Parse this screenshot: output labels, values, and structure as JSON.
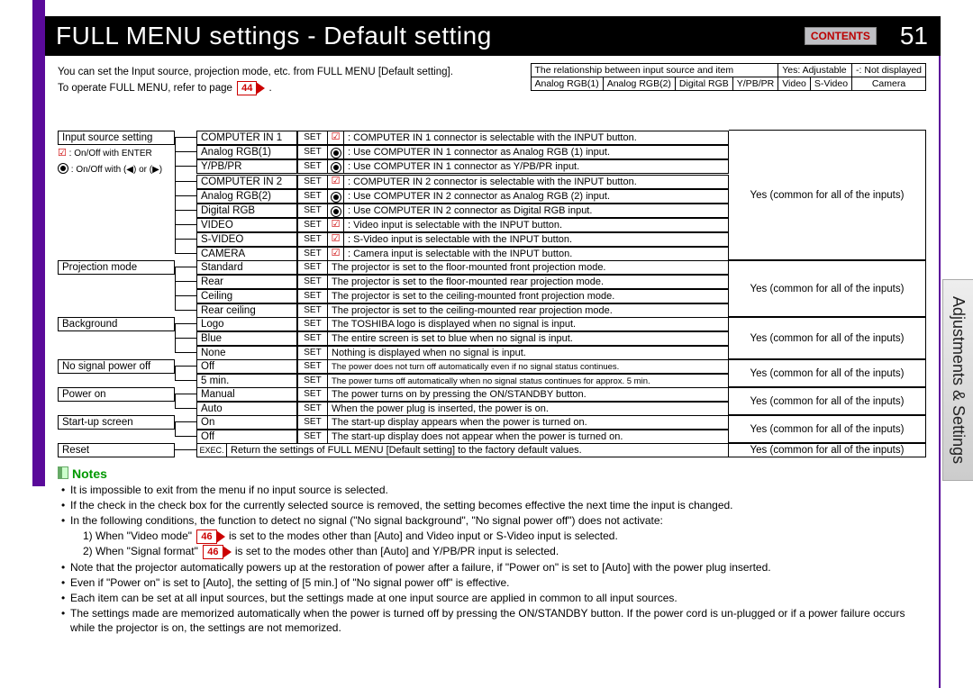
{
  "header": {
    "title": "FULL MENU settings - Default setting",
    "contents_btn": "CONTENTS",
    "page_number": "51",
    "side_tab": "Adjustments & Settings"
  },
  "intro": {
    "line1": "You can set the Input source, projection mode, etc. from FULL MENU [Default setting].",
    "line2_pre": "To operate FULL MENU, refer to page ",
    "line2_ref": "44",
    "line2_post": "."
  },
  "legend": {
    "cb": ": On/Off with ENTER",
    "dot_pre": ": On/Off with (",
    "dot_mid": ") or (",
    "dot_post": ")"
  },
  "rel": {
    "title_left": "The relationship between input source and item",
    "title_right_yes": "Yes: Adjustable",
    "title_right_dash": "-: Not displayed",
    "cols": [
      "Analog RGB(1)",
      "Analog RGB(2)",
      "Digital RGB",
      "Y/PB/PR",
      "Video",
      "S-Video",
      "Camera"
    ]
  },
  "yes_text": "Yes (common for all of the inputs)",
  "set_label": "SET",
  "exec_label": "EXEC.",
  "groups": [
    {
      "label": "Input source setting",
      "items": [
        {
          "name": "COMPUTER IN 1",
          "icon": "cb",
          "desc": ": COMPUTER IN 1 connector is selectable with the INPUT button."
        },
        {
          "name": "Analog RGB(1)",
          "icon": "dot",
          "desc": ": Use COMPUTER IN 1 connector as Analog RGB (1) input."
        },
        {
          "name": "Y/PB/PR",
          "icon": "dot",
          "desc": ": Use COMPUTER IN 1 connector as Y/PB/PR input."
        },
        {
          "name": "COMPUTER IN 2",
          "icon": "cb",
          "desc": ": COMPUTER IN 2 connector is selectable with the INPUT button."
        },
        {
          "name": "Analog RGB(2)",
          "icon": "dot",
          "desc": ": Use COMPUTER IN 2 connector as Analog RGB (2) input."
        },
        {
          "name": "Digital RGB",
          "icon": "dot",
          "desc": ": Use COMPUTER IN 2 connector as Digital RGB input."
        },
        {
          "name": "VIDEO",
          "icon": "cb",
          "desc": ": Video input is selectable with the INPUT button."
        },
        {
          "name": "S-VIDEO",
          "icon": "cb",
          "desc": ": S-Video input is selectable with the INPUT button."
        },
        {
          "name": "CAMERA",
          "icon": "cb",
          "desc": ": Camera input is selectable with the INPUT button."
        }
      ]
    },
    {
      "label": "Projection mode",
      "items": [
        {
          "name": "Standard",
          "desc": "The projector is set to the floor-mounted front projection mode."
        },
        {
          "name": "Rear",
          "desc": "The projector is set to the floor-mounted rear projection mode."
        },
        {
          "name": "Ceiling",
          "desc": "The projector is set to the ceiling-mounted front projection mode."
        },
        {
          "name": "Rear ceiling",
          "desc": "The projector is set to the ceiling-mounted rear projection mode."
        }
      ]
    },
    {
      "label": "Background",
      "items": [
        {
          "name": "Logo",
          "desc": "The TOSHIBA logo is displayed when no signal is input."
        },
        {
          "name": "Blue",
          "desc": "The entire screen is set to blue when no signal is input."
        },
        {
          "name": "None",
          "desc": "Nothing is displayed when no signal is input."
        }
      ]
    },
    {
      "label": "No signal power off",
      "items": [
        {
          "name": "Off",
          "desc": "The power does not turn off automatically even if no signal status continues.",
          "small": true
        },
        {
          "name": "5 min.",
          "desc": "The power turns off automatically when no signal status continues for approx. 5 min.",
          "small": true
        }
      ]
    },
    {
      "label": "Power on",
      "items": [
        {
          "name": "Manual",
          "desc": "The power turns on by pressing the ON/STANDBY button."
        },
        {
          "name": "Auto",
          "desc": "When the power plug is inserted, the power is on."
        }
      ]
    },
    {
      "label": "Start-up screen",
      "items": [
        {
          "name": "On",
          "desc": "The start-up display appears when the power is turned on."
        },
        {
          "name": "Off",
          "desc": "The start-up display does not appear when the power is turned on."
        }
      ]
    }
  ],
  "reset": {
    "label": "Reset",
    "desc": "Return the settings of FULL MENU [Default setting] to the factory default values."
  },
  "notes_label": "Notes",
  "notes": {
    "n1": "It is impossible to exit from the menu if no input source is selected.",
    "n2": "If the check in the check box for the currently selected source is removed, the setting becomes effective the next time the input is changed.",
    "n3": "In the following conditions, the function to detect no signal (\"No signal background\", \"No signal power off\") does not activate:",
    "n3a_pre": "1) When \"Video mode\" ",
    "n3a_ref": "46",
    "n3a_post": " is set to the modes other than [Auto] and Video input or S-Video input is selected.",
    "n3b_pre": "2) When \"Signal format\" ",
    "n3b_ref": "46",
    "n3b_post": " is set to the modes other than [Auto] and Y/PB/PR input is selected.",
    "n4": "Note that the projector automatically powers up at the restoration of power after a failure, if \"Power on\" is set to [Auto] with the power plug inserted.",
    "n5": "Even if \"Power on\" is set to [Auto], the setting of [5 min.] of \"No signal power off\" is effective.",
    "n6": "Each item can be set at all input sources, but the settings made at one input source are applied in common to all input sources.",
    "n7": "The settings made are memorized automatically when the power is turned off by pressing the ON/STANDBY button. If the power cord is un-plugged or if a power failure occurs while the projector is on, the settings are not memorized."
  }
}
